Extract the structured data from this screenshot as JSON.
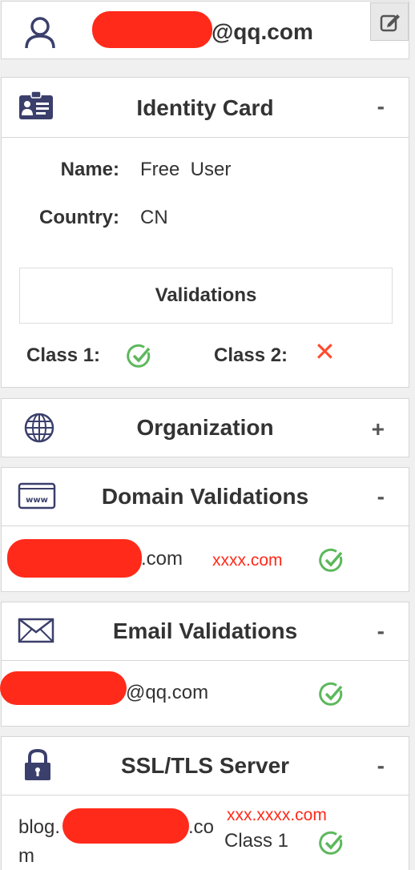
{
  "account": {
    "email_suffix": "@qq.com",
    "edit_icon": "edit-icon",
    "user_icon": "user-icon"
  },
  "identity": {
    "title": "Identity Card",
    "toggle": "-",
    "name_label": "Name:",
    "name_value": "Free  User",
    "country_label": "Country:",
    "country_value": "CN",
    "validations_title": "Validations",
    "class1_label": "Class 1:",
    "class2_label": "Class 2:",
    "class1_status": "check-icon",
    "class2_status": "x-icon"
  },
  "organization": {
    "title": "Organization",
    "toggle": "+"
  },
  "domain": {
    "title": "Domain Validations",
    "toggle": "-",
    "domain_suffix": ".com",
    "domain_secondary": "xxxx.com",
    "status": "check-icon"
  },
  "email": {
    "title": "Email Validations",
    "toggle": "-",
    "email_suffix": "@qq.com",
    "status": "check-icon"
  },
  "ssl": {
    "title": "SSL/TLS Server",
    "toggle": "-",
    "host_prefix": "blog.",
    "host_suffix": ".co",
    "host_wrap": "m",
    "host_secondary": "xxx.xxxx.com",
    "class": "Class 1",
    "status": "check-icon"
  },
  "colors": {
    "accent_check": "#5cb85c",
    "error": "#ff2a1a",
    "icon_navy": "#3b3f6b"
  }
}
